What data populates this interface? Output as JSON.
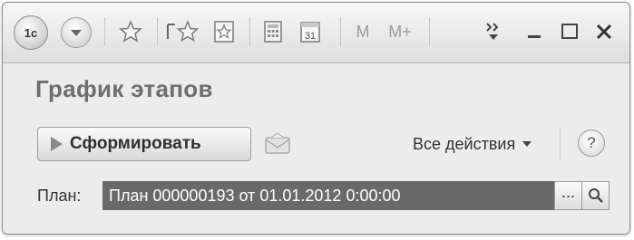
{
  "toolbar": {
    "logo_text": "1c",
    "icons": [
      "logo-icon",
      "menu-icon",
      "star-icon",
      "history-icon",
      "favorites-icon",
      "calculator-icon",
      "calendar-icon",
      "m-icon",
      "m-plus-icon",
      "more-icon",
      "minimize-icon",
      "maximize-icon",
      "close-icon"
    ],
    "m_label": "M",
    "m_plus_label": "M+",
    "calendar_day": "31"
  },
  "form": {
    "title": "График этапов",
    "generate_label": "Сформировать",
    "all_actions_label": "Все действия",
    "help_label": "?",
    "plan_label": "План:",
    "plan_value": "План 000000193 от 01.01.2012 0:00:00",
    "select_label": "...",
    "colors": {
      "field_bg": "#696969",
      "field_text": "#ffffff",
      "title_text": "#6e6e6e"
    }
  }
}
